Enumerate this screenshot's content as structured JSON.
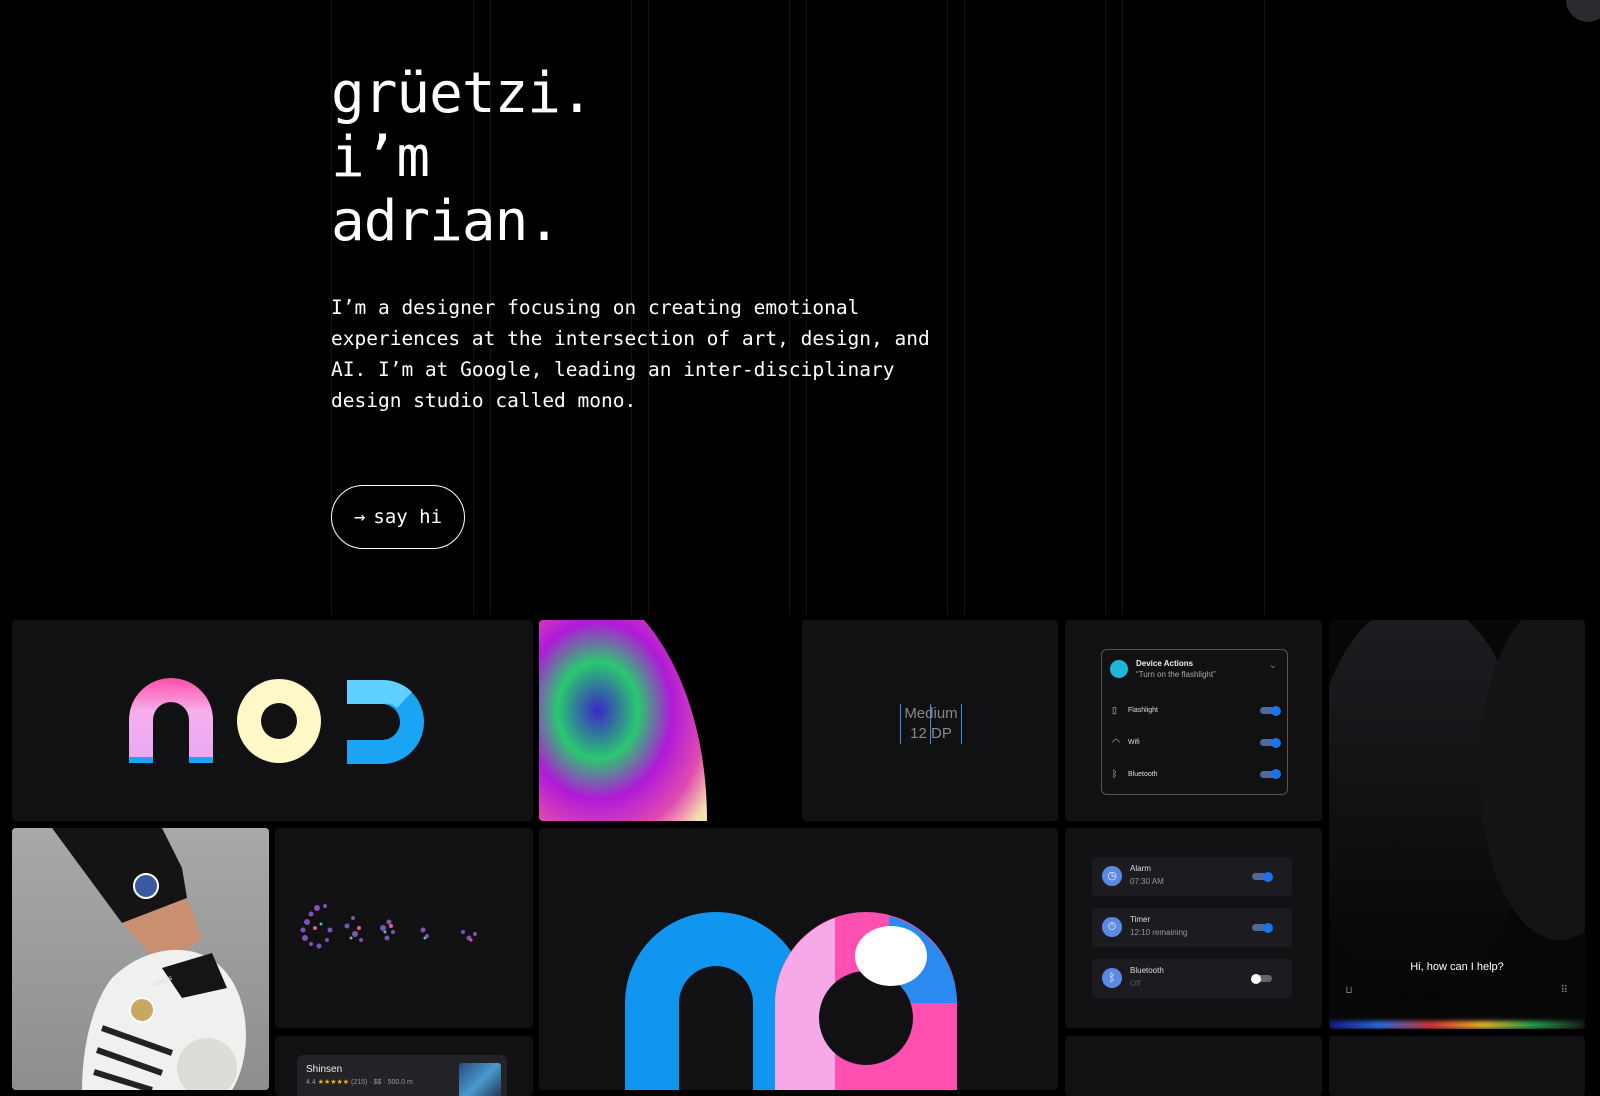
{
  "hero": {
    "title_lines": [
      "grüetzi.",
      "i’m",
      "adrian."
    ],
    "description": "I’m a designer focusing on creating emotional experiences at the intersection of art, design, and AI. I’m at Google, leading an inter-disciplinary design studio called mono.",
    "cta_arrow": "→",
    "cta_label": "say hi"
  },
  "tiles": {
    "nod_logo": "nod",
    "medium_dp": {
      "line1": "Medium",
      "line2": "12 DP"
    },
    "device_actions": {
      "title": "Device Actions",
      "subtitle": "“Turn on the flashlight”",
      "rows": [
        {
          "icon": "flashlight-icon",
          "label": "Flashlight",
          "on": true
        },
        {
          "icon": "wifi-icon",
          "label": "Wifi",
          "on": true
        },
        {
          "icon": "bluetooth-icon",
          "label": "Bluetooth",
          "on": true
        }
      ]
    },
    "alarm_card": {
      "rows": [
        {
          "icon": "clock-icon",
          "title": "Alarm",
          "subtitle": "07:30 AM",
          "on": true
        },
        {
          "icon": "timer-icon",
          "title": "Timer",
          "subtitle": "12:10 remaining",
          "on": true
        },
        {
          "icon": "bluetooth-icon",
          "title": "Bluetooth",
          "subtitle": "Off",
          "on": false
        }
      ]
    },
    "assistant": {
      "prompt": "Hi, how can I help?"
    },
    "shinsen": {
      "name": "Shinsen",
      "rating": "4.4",
      "stars": "★★★★★",
      "meta": "(215) · $$ · 500.0 m"
    },
    "shoe_brand": "adidas"
  },
  "colors": {
    "background": "#000000",
    "tile": "#111114",
    "accent_blue": "#1a73e8",
    "nod_pink": "#f7a8e8",
    "nod_blue": "#1aa4f4",
    "mono_blue": "#1196f0",
    "mono_pink": "#ff4fb0"
  }
}
